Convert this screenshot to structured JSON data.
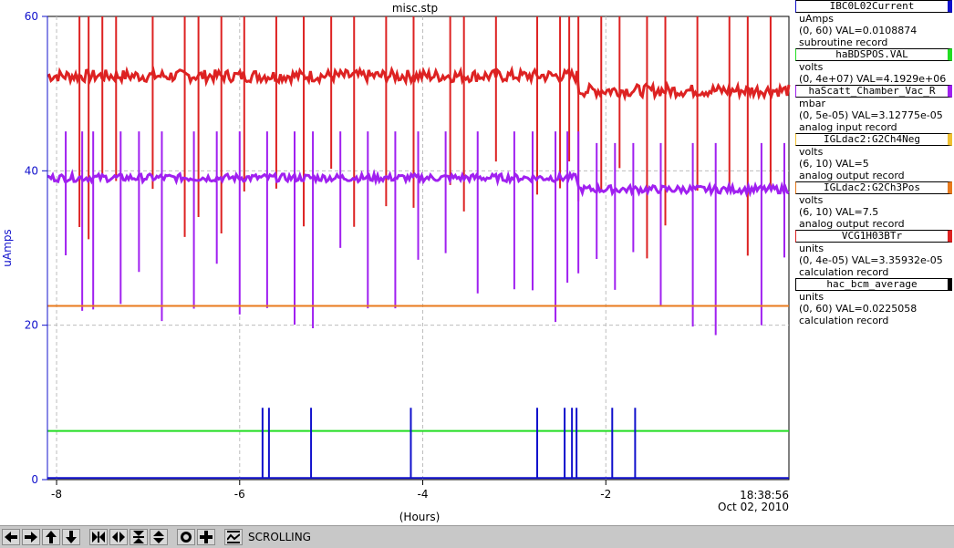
{
  "chart_data": {
    "type": "line",
    "title": "misc.stp",
    "xlabel": "(Hours)",
    "ylabel": "uAmps",
    "xlim": [
      -8.1,
      0
    ],
    "ylim": [
      0,
      60
    ],
    "x_ticks": [
      -8,
      -6,
      -4,
      -2
    ],
    "x_tick_labels": [
      "-8",
      "-6",
      "-4",
      "-2"
    ],
    "y_ticks": [
      0,
      20,
      40,
      60
    ],
    "y_tick_labels": [
      "0",
      "20",
      "40",
      "60"
    ],
    "end_time": "18:38:56",
    "end_date": "Oct 02, 2010",
    "grid": true,
    "series": [
      {
        "name": "VCG1H03BTr",
        "color": "#dd2222",
        "base": 52.3,
        "base_late": 50.4,
        "noise": 0.8,
        "spike_x": [
          -7.75,
          -7.65,
          -7.5,
          -7.35,
          -6.95,
          -6.6,
          -6.45,
          -6.2,
          -5.95,
          -5.6,
          -5.3,
          -5.0,
          -4.75,
          -4.4,
          -4.1,
          -3.7,
          -3.55,
          -3.2,
          -2.75,
          -2.5,
          -2.4,
          -2.3,
          -2.05,
          -1.85,
          -1.55,
          -1.35,
          -1.0,
          -0.65,
          -0.45,
          -0.2
        ]
      },
      {
        "name": "haScatt_Chamber_Vac_R",
        "color": "#a020f0",
        "base": 39.1,
        "base_late": 37.6,
        "noise": 0.5,
        "spike_x": [
          -7.9,
          -7.72,
          -7.6,
          -7.3,
          -7.1,
          -6.85,
          -6.5,
          -6.25,
          -6.0,
          -5.7,
          -5.4,
          -5.2,
          -4.9,
          -4.6,
          -4.3,
          -4.05,
          -3.75,
          -3.4,
          -3.0,
          -2.8,
          -2.55,
          -2.42,
          -2.3,
          -2.1,
          -1.9,
          -1.7,
          -1.4,
          -1.05,
          -0.8,
          -0.3,
          -0.05
        ]
      },
      {
        "name": "IGLdac2:G2Ch3Pos",
        "color": "#e87a1c",
        "base": 22.5
      },
      {
        "name": "haBDSPOS.VAL",
        "color": "#22dd22",
        "base": 6.3
      },
      {
        "name": "IBC0L02Current",
        "color": "#1010cc",
        "base": 0.2,
        "spike_x": [
          -5.75,
          -5.68,
          -5.22,
          -4.13,
          -2.75,
          -2.45,
          -2.37,
          -2.32,
          -1.93,
          -1.68
        ],
        "spike_y": 9.3
      }
    ]
  },
  "legend": {
    "items": [
      {
        "name": "IBC0L02Current",
        "color": "#1010cc",
        "units": "uAmps",
        "range_val": "(0, 60) VAL=0.0108874",
        "record": "subroutine record"
      },
      {
        "name": "haBDSPOS.VAL",
        "color": "#22dd22",
        "units": "volts",
        "range_val": "(0, 4e+07) VAL=4.1929e+06",
        "record": ""
      },
      {
        "name": "haScatt_Chamber_Vac_R",
        "color": "#a020f0",
        "units": "mbar",
        "range_val": "(0, 5e-05) VAL=3.12775e-05",
        "record": "analog input record"
      },
      {
        "name": "IGLdac2:G2Ch4Neg",
        "color": "#f0c030",
        "units": "volts",
        "range_val": "(6, 10) VAL=5",
        "record": "analog output record"
      },
      {
        "name": "IGLdac2:G2Ch3Pos",
        "color": "#e87a1c",
        "units": "volts",
        "range_val": "(6, 10) VAL=7.5",
        "record": "analog output record"
      },
      {
        "name": "VCG1H03BTr",
        "color": "#dd2222",
        "units": "units",
        "range_val": "(0, 4e-05) VAL=3.35932e-05",
        "record": "calculation record"
      },
      {
        "name": "hac_bcm_average",
        "color": "#000000",
        "units": "units",
        "range_val": "(0, 60) VAL=0.0225058",
        "record": "calculation record"
      }
    ]
  },
  "toolbar": {
    "buttons": [
      {
        "name": "pan-left-icon"
      },
      {
        "name": "pan-right-icon"
      },
      {
        "name": "pan-up-icon"
      },
      {
        "name": "pan-down-icon"
      },
      {
        "name": "zoom-in-x-icon"
      },
      {
        "name": "zoom-out-x-icon"
      },
      {
        "name": "zoom-in-y-icon"
      },
      {
        "name": "zoom-out-y-icon"
      },
      {
        "name": "auto-scale-icon"
      },
      {
        "name": "add-icon"
      },
      {
        "name": "scroll-mode-icon"
      }
    ],
    "status": "SCROLLING"
  }
}
